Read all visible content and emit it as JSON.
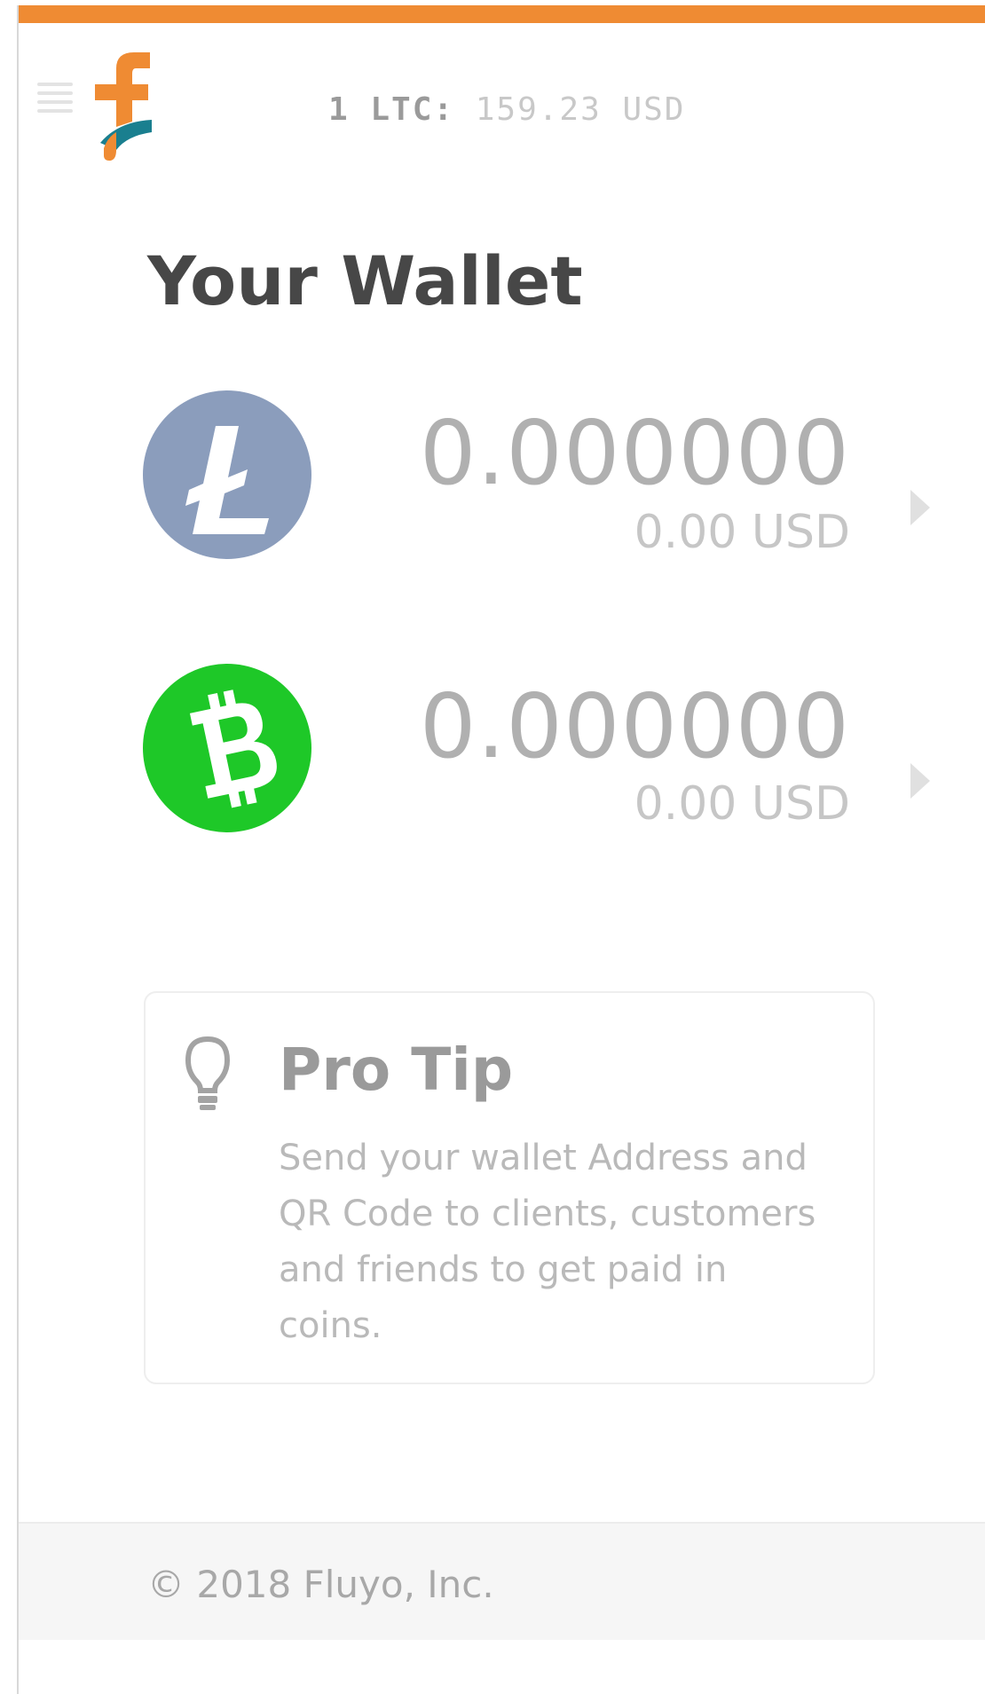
{
  "header": {
    "rate_prefix": "1 LTC:",
    "rate_value": "159.23 USD",
    "menu_icon": "hamburger-menu-icon",
    "logo_icon": "fluyo-logo-icon"
  },
  "wallet": {
    "title": "Your Wallet",
    "coins": [
      {
        "icon": "litecoin-icon",
        "icon_color": "#8b9dbc",
        "amount": "0.000000",
        "usd": "0.00 USD"
      },
      {
        "icon": "bitcoin-cash-icon",
        "icon_color": "#1ec828",
        "amount": "0.000000",
        "usd": "0.00 USD"
      }
    ]
  },
  "tip": {
    "icon": "lightbulb-icon",
    "title": "Pro Tip",
    "body": "Send  your wallet Address and QR Code to clients, customers and friends to get paid in coins."
  },
  "footer": {
    "copyright": "© 2018 Fluyo, Inc."
  },
  "colors": {
    "accent": "#ef8b33",
    "logo_teal": "#1a7f8f",
    "litecoin": "#8b9dbc",
    "bitcoin_cash": "#1ec828"
  }
}
